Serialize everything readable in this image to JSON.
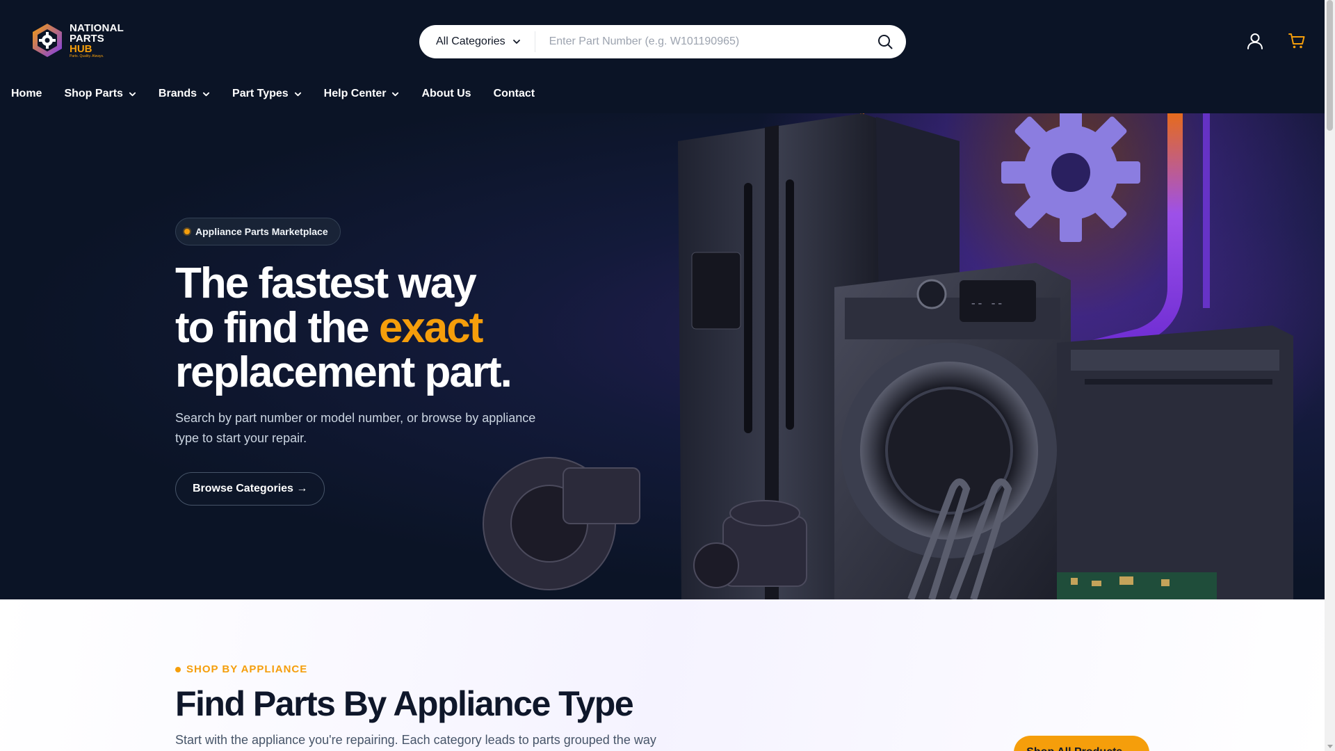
{
  "header": {
    "logo": {
      "line1": "NATIONAL",
      "line2": "PARTS",
      "line3": "HUB",
      "tagline": "Parts. Quality. Always."
    },
    "search": {
      "category_label": "All Categories",
      "placeholder": "Enter Part Number (e.g. W101190965)",
      "value": ""
    },
    "icons": {
      "account": "user-icon",
      "cart": "cart-icon",
      "search": "search-icon"
    }
  },
  "nav": {
    "items": [
      {
        "label": "Home",
        "has_dropdown": false
      },
      {
        "label": "Shop Parts",
        "has_dropdown": true
      },
      {
        "label": "Brands",
        "has_dropdown": true
      },
      {
        "label": "Part Types",
        "has_dropdown": true
      },
      {
        "label": "Help Center",
        "has_dropdown": true
      },
      {
        "label": "About Us",
        "has_dropdown": false
      },
      {
        "label": "Contact",
        "has_dropdown": false
      }
    ]
  },
  "hero": {
    "badge": "Appliance Parts Marketplace",
    "title_line1": "The fastest way",
    "title_line2_pre": "to find the ",
    "title_line2_accent": "exact",
    "title_line3": "replacement part.",
    "subtitle": "Search by part number or model number, or browse by appliance type to start your repair.",
    "button": "Browse Categories →"
  },
  "section": {
    "eyebrow": "SHOP BY APPLIANCE",
    "title": "Find Parts By Appliance Type",
    "subtitle": "Start with the appliance you're repairing. Each category leads to parts grouped the way",
    "button": "Shop All Products →"
  },
  "colors": {
    "header_bg": "#0b1426",
    "accent": "#f59e0b",
    "purple": "#7c3aed"
  }
}
